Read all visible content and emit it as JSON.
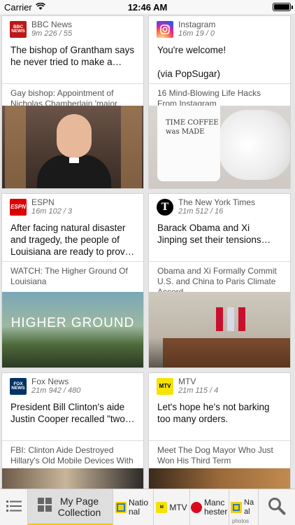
{
  "status_bar": {
    "carrier": "Carrier",
    "time": "12:46 AM"
  },
  "cards": [
    {
      "source": "BBC News",
      "logo_text": "BBC NEWS",
      "logo_color": "#bb1919",
      "meta": "9m  226 / 55",
      "headline": "The bishop of Grantham says he never tried to make a secret of his sexuality",
      "sub": "Gay bishop: Appointment of Nicholas Chamberlain 'major error' says Gafcon",
      "image": "bishop-photo"
    },
    {
      "source": "Instagram",
      "logo_text": "",
      "logo_color": "#c13584",
      "meta": "16m  19 / 0",
      "headline": "You're welcome!\n\n(via PopSugar)",
      "sub": "16 Mind-Blowing Life Hacks From Instagram",
      "image_text": "TIME COFFEE\nwas MADE",
      "image": "coffee-cup-photo"
    },
    {
      "source": "ESPN",
      "logo_text": "ESPN",
      "logo_color": "#d00",
      "meta": "16m  102 / 3",
      "headline": "After facing natural disaster and tragedy, the people of Louisiana are ready to prove their resilience",
      "sub": "WATCH: The Higher Ground Of Louisiana",
      "image_text": "HIGHER GROUND",
      "image": "flooded-street-photo"
    },
    {
      "source": "The New York Times",
      "logo_text": "T",
      "logo_color": "#000000",
      "meta": "21m  512 / 16",
      "headline": "Barack Obama and Xi Jinping set their tensions aside and commit to the Paris agreement",
      "sub": "Obama and Xi Formally Commit U.S. and China to Paris Climate Accord",
      "image": "summit-meeting-photo"
    },
    {
      "source": "Fox News",
      "logo_text": "FOX NEWS",
      "logo_color": "#003366",
      "meta": "21m  942 / 480",
      "headline": "President Bill Clinton's aide Justin Cooper recalled \"two instances\"",
      "sub": "FBI: Clinton Aide Destroyed Hillary's Old Mobile Devices With a Hammer",
      "image": "clinton-photo"
    },
    {
      "source": "MTV",
      "logo_text": "MTV",
      "logo_color": "#f5e300",
      "meta": "21m  115 / 4",
      "headline": "Let's hope he's not barking too many orders.",
      "sub": "Meet The Dog Mayor Who Just Won His Third Term",
      "image": "dog-photo"
    }
  ],
  "tab_bar": {
    "collection_label": "My Page Collection",
    "national_label": "National",
    "mtv_label": "MTV",
    "manchester_label": "Manchester",
    "natphotos_label": "Na al",
    "natphotos_sub": "photos"
  },
  "colors": {
    "accent": "#f5c400"
  }
}
